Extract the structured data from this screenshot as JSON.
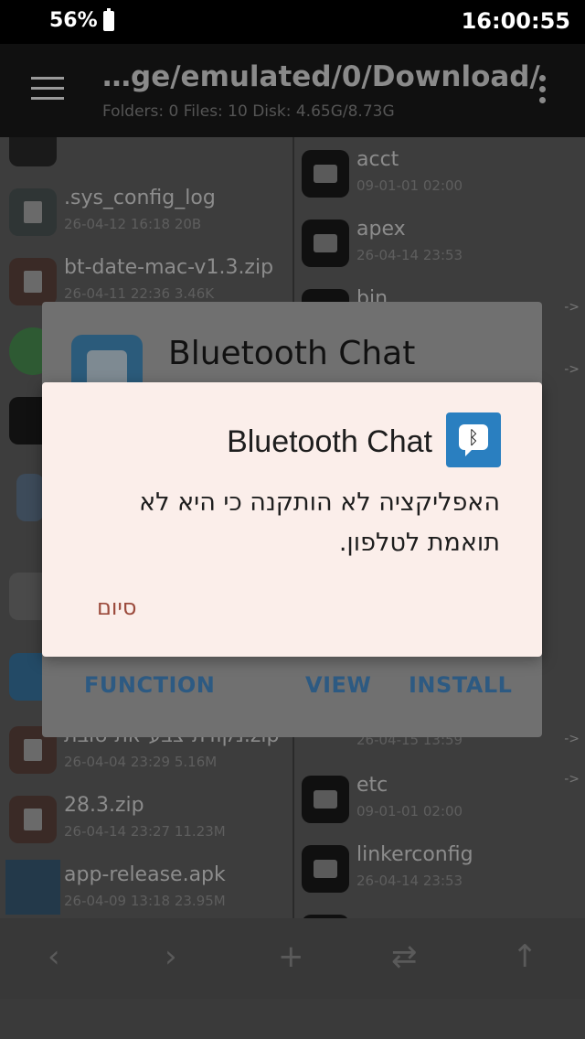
{
  "status": {
    "battery": "56%",
    "time": "16:00:55"
  },
  "appbar": {
    "path": "…ge/emulated/0/Download/",
    "info": "Folders: 0  Files: 10  Disk: 4.65G/8.73G"
  },
  "left_files": [
    {
      "name": "",
      "meta": "",
      "kind": "unknown"
    },
    {
      "name": ".sys_config_log",
      "meta": "26-04-12 16:18  20B",
      "kind": "doc"
    },
    {
      "name": "bt-date-mac-v1.3.zip",
      "meta": "26-04-11 22:36  3.46K",
      "kind": "zip"
    },
    {
      "name": "",
      "meta": "",
      "kind": "app"
    },
    {
      "name": "",
      "meta": "",
      "kind": "app"
    },
    {
      "name": "",
      "meta": "",
      "kind": "app"
    },
    {
      "name": "",
      "meta": "",
      "kind": "app"
    },
    {
      "name": "",
      "meta": "",
      "kind": "app"
    },
    {
      "name": "נקודת-צבע-את-סובת.zip",
      "meta": "26-04-04 23:29  5.16M",
      "kind": "zip"
    },
    {
      "name": "28.3.zip",
      "meta": "26-04-14 23:27  11.23M",
      "kind": "zip"
    },
    {
      "name": "app-release.apk",
      "meta": "26-04-09 13:18  23.95M",
      "kind": "apk"
    }
  ],
  "right_files": [
    {
      "name": "acct",
      "meta": "09-01-01 02:00",
      "arrow": ""
    },
    {
      "name": "apex",
      "meta": "26-04-14 23:53",
      "arrow": ""
    },
    {
      "name": "bin",
      "meta": "",
      "arrow": "->"
    },
    {
      "name": "",
      "meta": "",
      "arrow": "->"
    },
    {
      "name": "",
      "meta": "",
      "arrow": ""
    },
    {
      "name": "",
      "meta": "",
      "arrow": ""
    },
    {
      "name": "",
      "meta": "",
      "arrow": ""
    },
    {
      "name": "",
      "meta": "",
      "arrow": "->"
    },
    {
      "name": "",
      "meta": "26-04-15 13:59",
      "arrow": ""
    },
    {
      "name": "etc",
      "meta": "09-01-01 02:00",
      "arrow": "->"
    },
    {
      "name": "linkerconfig",
      "meta": "26-04-14 23:53",
      "arrow": ""
    }
  ],
  "bottom_nav": {
    "back": "‹",
    "forward": "›",
    "add": "+",
    "swap": "⇄",
    "up": "↑"
  },
  "dialog_install": {
    "title": "Bluetooth Chat",
    "buttons": {
      "function": "FUNCTION",
      "view": "VIEW",
      "install": "INSTALL"
    }
  },
  "dialog_error": {
    "title": "Bluetooth Chat",
    "message": "האפליקציה לא הותקנה כי היא לא תואמת לטלפון.",
    "button": "סיום",
    "icon": "bluetooth-chat-icon"
  }
}
